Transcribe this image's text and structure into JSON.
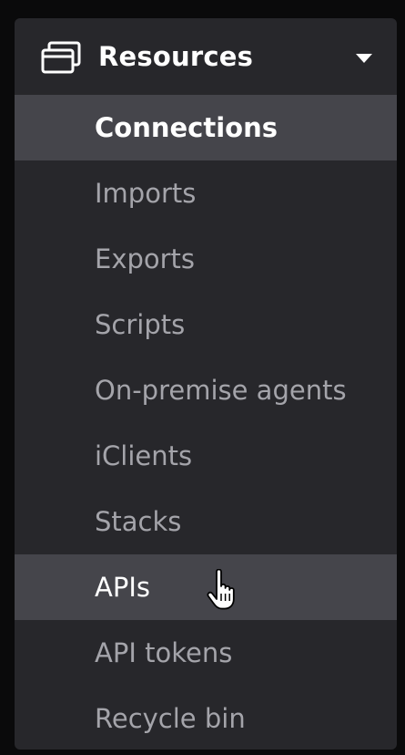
{
  "menu": {
    "title": "Resources",
    "icon": "windows-stack-icon",
    "caret_icon": "caret-down-icon",
    "items": [
      {
        "label": "Connections",
        "active": true
      },
      {
        "label": "Imports",
        "active": false
      },
      {
        "label": "Exports",
        "active": false
      },
      {
        "label": "Scripts",
        "active": false
      },
      {
        "label": "On-premise agents",
        "active": false
      },
      {
        "label": "iClients",
        "active": false
      },
      {
        "label": "Stacks",
        "active": false
      },
      {
        "label": "APIs",
        "active": true
      },
      {
        "label": "API tokens",
        "active": false
      },
      {
        "label": "Recycle bin",
        "active": false
      }
    ]
  },
  "colors": {
    "background": "#0a0a0b",
    "panel": "#27272b",
    "active_row": "#45454b",
    "text_active": "#ffffff",
    "text_muted": "#a4a4aa"
  },
  "cursor_icon": "hand-pointer-icon"
}
